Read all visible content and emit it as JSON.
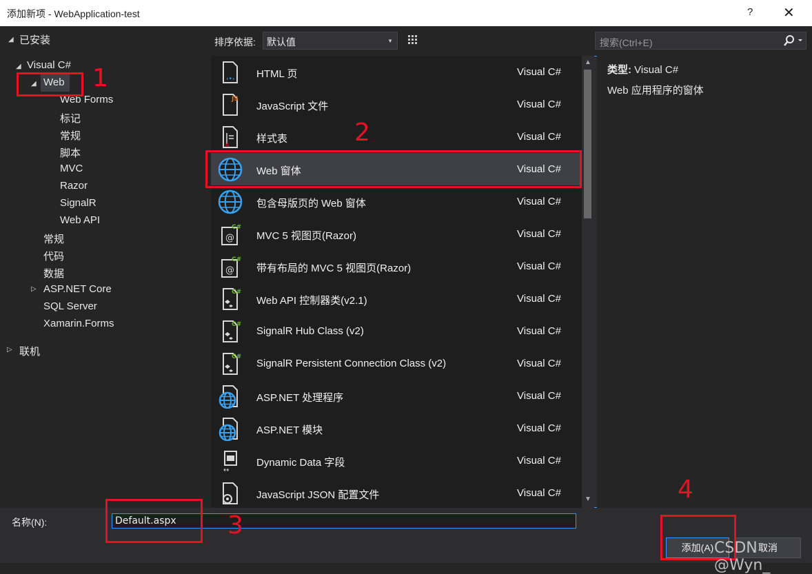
{
  "window": {
    "title": "添加新项 - WebApplication-test",
    "help": "?",
    "close": "✕"
  },
  "tree": {
    "installed": "已安装",
    "visual_csharp": "Visual C#",
    "web": "Web",
    "web_children": [
      "Web Forms",
      "标记",
      "常规",
      "脚本",
      "MVC",
      "Razor",
      "SignalR",
      "Web API"
    ],
    "csharp_children": [
      "常规",
      "代码",
      "数据"
    ],
    "aspnet_core": "ASP.NET Core",
    "sql_server": "SQL Server",
    "xamarin": "Xamarin.Forms",
    "online": "联机"
  },
  "toolbar": {
    "sort_label": "排序依据:",
    "sort_value": "默认值"
  },
  "search": {
    "placeholder": "搜索(Ctrl+E)"
  },
  "templates": [
    {
      "name": "HTML 页",
      "type": "Visual C#",
      "icon": "html-page-icon"
    },
    {
      "name": "JavaScript 文件",
      "type": "Visual C#",
      "icon": "javascript-file-icon"
    },
    {
      "name": "样式表",
      "type": "Visual C#",
      "icon": "stylesheet-icon"
    },
    {
      "name": "Web 窗体",
      "type": "Visual C#",
      "icon": "globe-icon"
    },
    {
      "name": "包含母版页的 Web 窗体",
      "type": "Visual C#",
      "icon": "globe-icon"
    },
    {
      "name": "MVC 5 视图页(Razor)",
      "type": "Visual C#",
      "icon": "razor-view-icon"
    },
    {
      "name": "带有布局的 MVC 5 视图页(Razor)",
      "type": "Visual C#",
      "icon": "razor-view-icon"
    },
    {
      "name": "Web API 控制器类(v2.1)",
      "type": "Visual C#",
      "icon": "csharp-class-icon"
    },
    {
      "name": "SignalR Hub Class (v2)",
      "type": "Visual C#",
      "icon": "csharp-class-icon"
    },
    {
      "name": "SignalR Persistent Connection Class (v2)",
      "type": "Visual C#",
      "icon": "csharp-class-icon"
    },
    {
      "name": "ASP.NET 处理程序",
      "type": "Visual C#",
      "icon": "globe-file-icon"
    },
    {
      "name": "ASP.NET 模块",
      "type": "Visual C#",
      "icon": "globe-file-icon"
    },
    {
      "name": "Dynamic Data 字段",
      "type": "Visual C#",
      "icon": "dynamic-data-icon"
    },
    {
      "name": "JavaScript JSON 配置文件",
      "type": "Visual C#",
      "icon": "json-config-icon"
    }
  ],
  "selected_template": 3,
  "details": {
    "type_label": "类型:",
    "type_value": "Visual C#",
    "description": "Web 应用程序的窗体"
  },
  "bottom": {
    "name_label": "名称(N):",
    "name_value": "Default.aspx",
    "add_button": "添加(A)",
    "cancel_button": "取消"
  },
  "annotations": [
    "1",
    "2",
    "3",
    "4"
  ],
  "watermark": "CSDN @Wyn_",
  "colors": {
    "accent": "#3399ff",
    "annotation": "#e81123",
    "background": "#252526"
  }
}
